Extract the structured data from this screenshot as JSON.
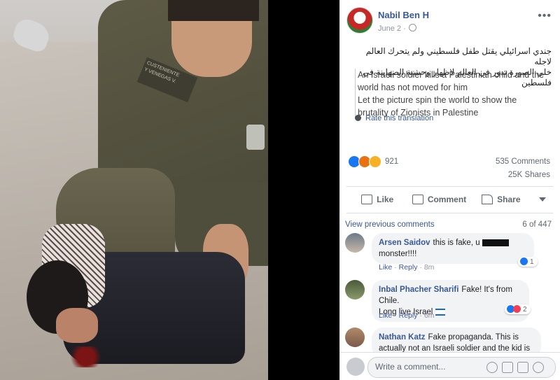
{
  "post": {
    "author": "Nabil Ben H",
    "date": "June 2",
    "more_label": "•••",
    "arabic_text_line1": "جندي اسرائيلي يقتل طفل فلسطيني ولم يتحرك العالم لاجله",
    "arabic_text_line2": "خلي الصورة تدور في العالم لاظهار وحشية الصهاينة في فلسطين",
    "translation_line1": "An Israeli soldier kills a Palestinian child and the world has not moved for him",
    "translation_line2": "Let the picture spin the world to show the brutality of Zionists in Palestine",
    "rate_translation": "Rate this translation",
    "reaction_count": "921",
    "comments_count": "535 Comments",
    "shares_count": "25K Shares"
  },
  "actions": {
    "like": "Like",
    "comment": "Comment",
    "share": "Share"
  },
  "comments_section": {
    "view_previous": "View previous comments",
    "pagination": "6 of 447",
    "comments": [
      {
        "author": "Arsen Saidov",
        "text_part1": "this is fake, u",
        "text_part2": "monster!!!!",
        "like": "Like",
        "reply": "Reply",
        "time": "8m",
        "reaction_count": "1"
      },
      {
        "author": "Inbal Phacher Sharifi",
        "text_part1": "Fake! It's from Chile.",
        "text_part2": "Long live Israel",
        "like": "Like",
        "reply": "Reply",
        "time": "6m",
        "reaction_count": "2"
      },
      {
        "author": "Nathan Katz",
        "text_part1": "Fake propaganda. This is",
        "text_part2": "actually not an Israeli soldier and the kid is"
      }
    ],
    "write_placeholder": "Write a comment..."
  },
  "photo": {
    "badge_text_line1": "CUSTENIENTE",
    "badge_text_line2": "Y VENEGAS V."
  },
  "colors": {
    "link_blue": "#385898",
    "name_blue": "#365899",
    "like_blue": "#1877f2",
    "muted_gray": "#606770"
  }
}
